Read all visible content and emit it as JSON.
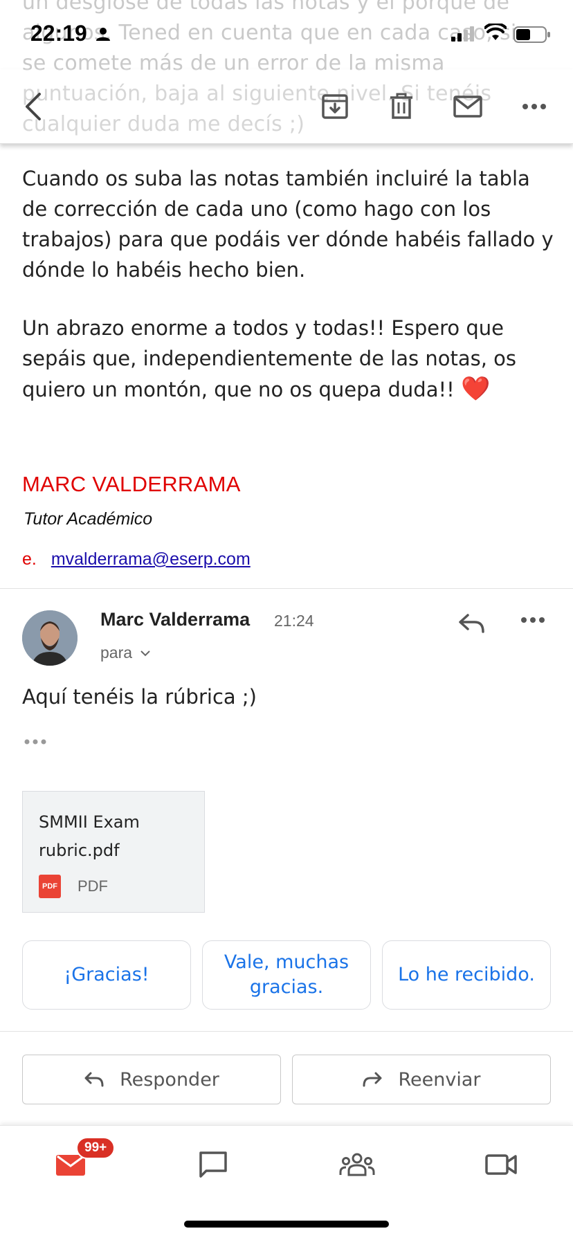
{
  "status_bar": {
    "time": "22:19"
  },
  "ghost_text": "un desglose de todas las notas y el porqué de algunos. Tened en cuenta que en cada caso, si se comete más de un error de la misma puntuación, baja al siguiente nivel. Si tenéis cualquier duda me decís ;)",
  "toolbar": {
    "back": "chevron-left-icon",
    "archive": "archive-icon",
    "delete": "trash-icon",
    "mark_unread": "mail-icon",
    "more": "more-horiz-icon"
  },
  "message1": {
    "paragraph1": "Cuando os suba las notas también incluiré la tabla de corrección de cada uno (como hago con los trabajos) para que podáis ver dónde habéis fallado y dónde lo habéis hecho bien.",
    "paragraph2": "Un abrazo enorme a todos y todas!! Espero que sepáis que, independientemente de las notas, os quiero un montón, que no os quepa duda!!",
    "heart": "❤️",
    "signature": {
      "name": "MARC VALDERRAMA",
      "role": "Tutor Académico",
      "email_prefix": "e.",
      "email": "mvalderrama@eserp.com"
    }
  },
  "message2": {
    "sender": "Marc Valderrama",
    "time": "21:24",
    "to_label": "para",
    "body": "Aquí tenéis la rúbrica ;)",
    "attachment": {
      "name": "SMMII Exam rubric.pdf",
      "type": "PDF",
      "icon_label": "PDF"
    }
  },
  "smart_replies": [
    "¡Gracias!",
    "Vale, muchas gracias.",
    "Lo he recibido."
  ],
  "actions": {
    "reply": "Responder",
    "forward": "Reenviar"
  },
  "bottom_nav": {
    "mail_badge": "99+",
    "items": [
      "mail-icon",
      "chat-icon",
      "spaces-icon",
      "meet-icon"
    ]
  },
  "colors": {
    "accent": "#1a73e8",
    "signature_red": "#e00000",
    "badge_red": "#d93025",
    "mail_red": "#ea4335"
  }
}
